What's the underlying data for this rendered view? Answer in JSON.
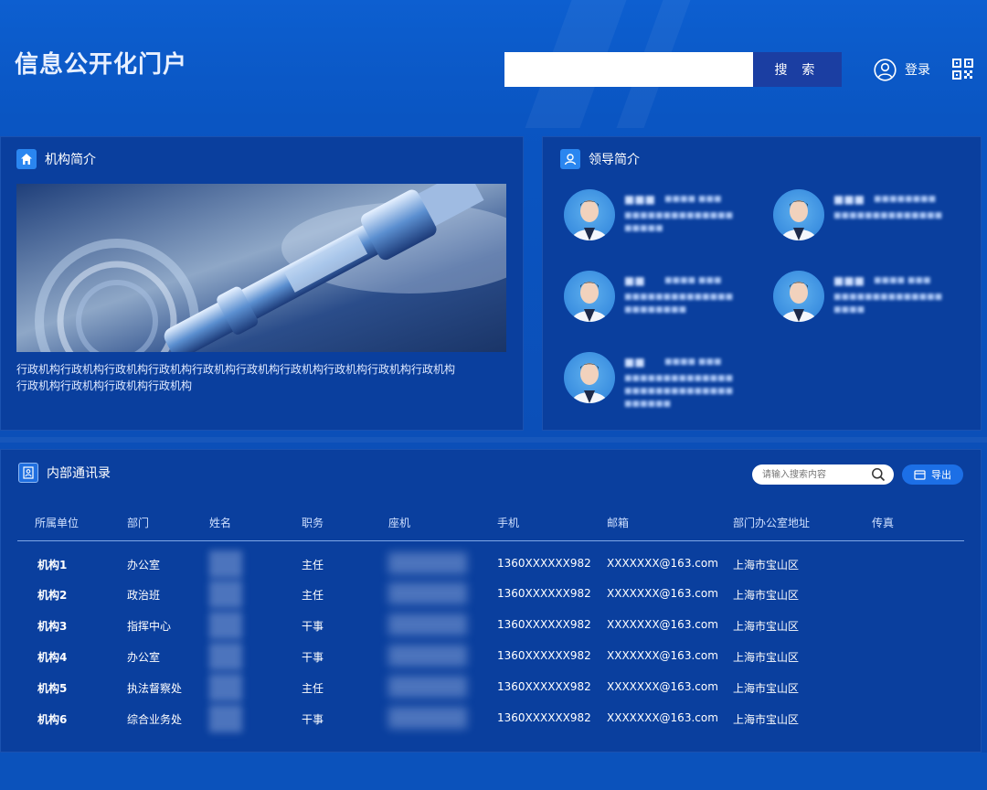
{
  "header": {
    "site_title": "信息公开化门户",
    "search_button": "搜 索",
    "search_placeholder": "",
    "login_label": "登录"
  },
  "org_intro": {
    "title": "机构简介",
    "text": "行政机构行政机构行政机构行政机构行政机构行政机构行政机构行政机构行政机构行政机构行政机构行政机构行政机构行政机构"
  },
  "leaders": {
    "title": "领导简介"
  },
  "directory": {
    "title": "内部通讯录",
    "search_placeholder": "请输入搜索内容",
    "export_label": "导出",
    "columns": [
      "所属单位",
      "部门",
      "姓名",
      "职务",
      "座机",
      "手机",
      "邮箱",
      "部门办公室地址",
      "传真"
    ],
    "rows": [
      {
        "unit": "机构1",
        "dept": "办公室",
        "title": "主任",
        "mobile": "1360XXXXXX982",
        "email": "XXXXXXX@163.com",
        "address": "上海市宝山区"
      },
      {
        "unit": "机构2",
        "dept": "政治班",
        "title": "主任",
        "mobile": "1360XXXXXX982",
        "email": "XXXXXXX@163.com",
        "address": "上海市宝山区"
      },
      {
        "unit": "机构3",
        "dept": "指挥中心",
        "title": "干事",
        "mobile": "1360XXXXXX982",
        "email": "XXXXXXX@163.com",
        "address": "上海市宝山区"
      },
      {
        "unit": "机构4",
        "dept": "办公室",
        "title": "干事",
        "mobile": "1360XXXXXX982",
        "email": "XXXXXXX@163.com",
        "address": "上海市宝山区"
      },
      {
        "unit": "机构5",
        "dept": "执法督察处",
        "title": "主任",
        "mobile": "1360XXXXXX982",
        "email": "XXXXXXX@163.com",
        "address": "上海市宝山区"
      },
      {
        "unit": "机构6",
        "dept": "综合业务处",
        "title": "干事",
        "mobile": "1360XXXXXX982",
        "email": "XXXXXXX@163.com",
        "address": "上海市宝山区"
      }
    ]
  }
}
